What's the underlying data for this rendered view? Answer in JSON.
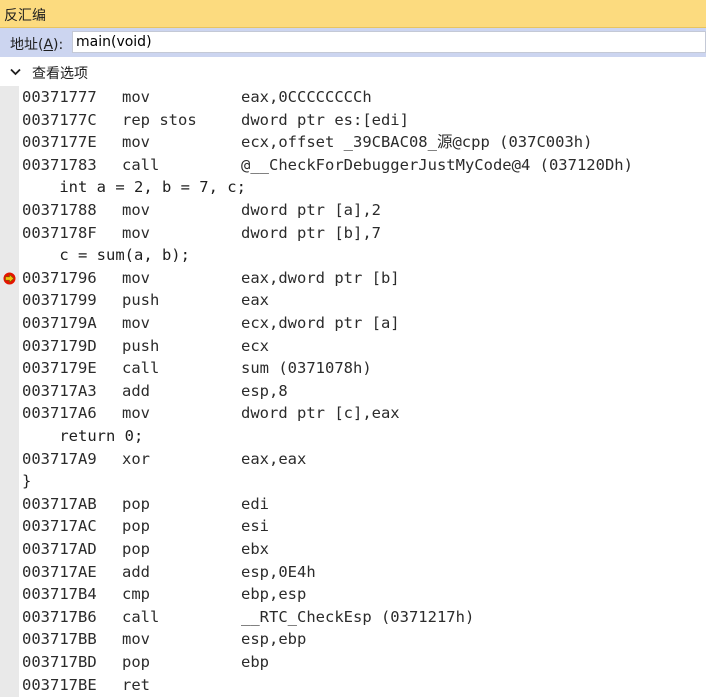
{
  "window": {
    "title": "反汇编"
  },
  "address_bar": {
    "label_prefix": "地址(",
    "label_key": "A",
    "label_suffix": "):",
    "value": "main(void)"
  },
  "view_options": {
    "label": "查看选项"
  },
  "lines": [
    {
      "kind": "asm",
      "addr": "00371777",
      "op": "mov",
      "args": "eax,0CCCCCCCCh"
    },
    {
      "kind": "asm",
      "addr": "0037177C",
      "op": "rep stos",
      "args": "dword ptr es:[edi]"
    },
    {
      "kind": "asm",
      "addr": "0037177E",
      "op": "mov",
      "args": "ecx,offset _39CBAC08_源@cpp (037C003h)"
    },
    {
      "kind": "asm",
      "addr": "00371783",
      "op": "call",
      "args": "@__CheckForDebuggerJustMyCode@4 (037120Dh)"
    },
    {
      "kind": "src",
      "text": "    int a = 2, b = 7, c;"
    },
    {
      "kind": "asm",
      "addr": "00371788",
      "op": "mov",
      "args": "dword ptr [a],2"
    },
    {
      "kind": "asm",
      "addr": "0037178F",
      "op": "mov",
      "args": "dword ptr [b],7"
    },
    {
      "kind": "src",
      "text": "    c = sum(a, b);"
    },
    {
      "kind": "asm",
      "addr": "00371796",
      "op": "mov",
      "args": "eax,dword ptr [b]",
      "breakpoint": true
    },
    {
      "kind": "asm",
      "addr": "00371799",
      "op": "push",
      "args": "eax"
    },
    {
      "kind": "asm",
      "addr": "0037179A",
      "op": "mov",
      "args": "ecx,dword ptr [a]"
    },
    {
      "kind": "asm",
      "addr": "0037179D",
      "op": "push",
      "args": "ecx"
    },
    {
      "kind": "asm",
      "addr": "0037179E",
      "op": "call",
      "args": "sum (0371078h)"
    },
    {
      "kind": "asm",
      "addr": "003717A3",
      "op": "add",
      "args": "esp,8"
    },
    {
      "kind": "asm",
      "addr": "003717A6",
      "op": "mov",
      "args": "dword ptr [c],eax"
    },
    {
      "kind": "src",
      "text": "    return 0;"
    },
    {
      "kind": "asm",
      "addr": "003717A9",
      "op": "xor",
      "args": "eax,eax"
    },
    {
      "kind": "src",
      "text": "}"
    },
    {
      "kind": "asm",
      "addr": "003717AB",
      "op": "pop",
      "args": "edi"
    },
    {
      "kind": "asm",
      "addr": "003717AC",
      "op": "pop",
      "args": "esi"
    },
    {
      "kind": "asm",
      "addr": "003717AD",
      "op": "pop",
      "args": "ebx"
    },
    {
      "kind": "asm",
      "addr": "003717AE",
      "op": "add",
      "args": "esp,0E4h"
    },
    {
      "kind": "asm",
      "addr": "003717B4",
      "op": "cmp",
      "args": "ebp,esp"
    },
    {
      "kind": "asm",
      "addr": "003717B6",
      "op": "call",
      "args": "__RTC_CheckEsp (0371217h)"
    },
    {
      "kind": "asm",
      "addr": "003717BB",
      "op": "mov",
      "args": "esp,ebp"
    },
    {
      "kind": "asm",
      "addr": "003717BD",
      "op": "pop",
      "args": "ebp"
    },
    {
      "kind": "asm",
      "addr": "003717BE",
      "op": "ret",
      "args": ""
    }
  ],
  "colors": {
    "title_bar": "#fcdb7f",
    "address_bar": "#ccd5f0",
    "gutter": "#e9e9e9",
    "breakpoint": "#e51400",
    "execution_arrow": "#f4c20d"
  }
}
